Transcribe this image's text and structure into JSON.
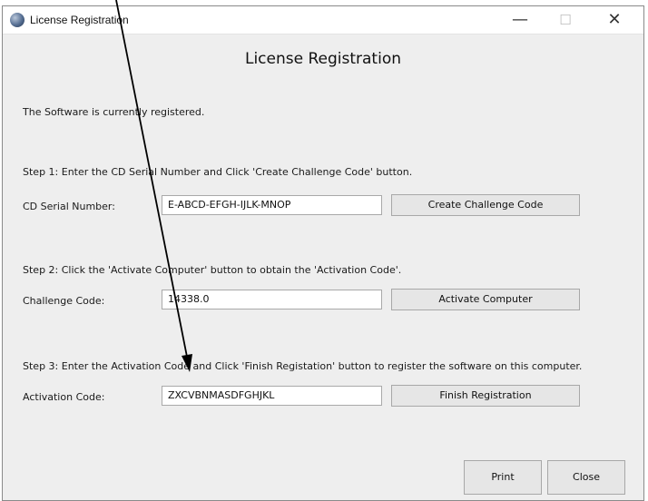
{
  "window": {
    "title": "License Registration",
    "controls": {
      "minimize": "—",
      "maximize": "☐",
      "close": "✕"
    }
  },
  "heading": "License Registration",
  "status_text": "The Software is currently registered.",
  "step1": {
    "instruction": "Step 1:   Enter the CD Serial Number and Click 'Create Challenge Code' button.",
    "label": "CD Serial Number:",
    "value": "E-ABCD-EFGH-IJLK-MNOP",
    "button": "Create Challenge Code"
  },
  "step2": {
    "instruction": "Step 2:   Click the 'Activate Computer' button to obtain the 'Activation Code'.",
    "label": "Challenge Code:",
    "value": "14338.0",
    "button": "Activate Computer"
  },
  "step3": {
    "instruction": "Step 3:   Enter the Activation Code and Click 'Finish Registation' button to register the software on this computer.",
    "label": "Activation Code:",
    "value": "ZXCVBNMASDFGHJKL",
    "button": "Finish Registration"
  },
  "footer": {
    "print": "Print",
    "close": "Close"
  }
}
